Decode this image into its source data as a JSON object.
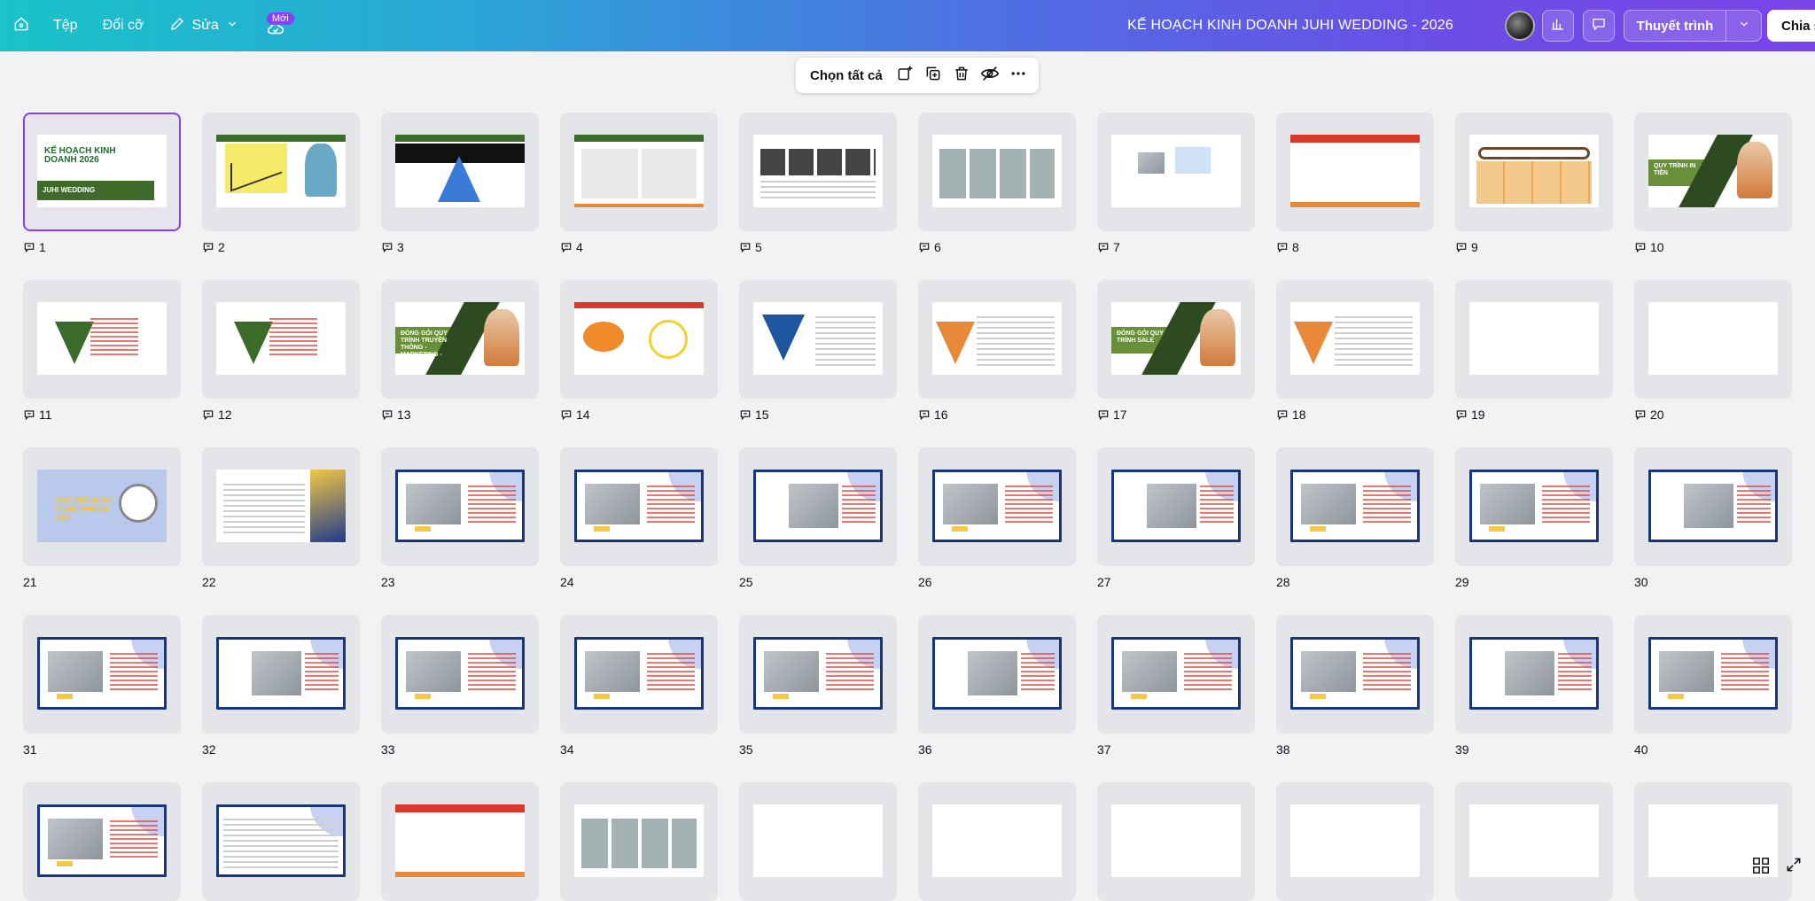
{
  "topbar": {
    "menu_file": "Tệp",
    "menu_resize": "Đổi cỡ",
    "menu_edit": "Sửa",
    "new_badge": "Mới",
    "doc_title": "KẾ HOẠCH KINH DOANH JUHI WEDDING - 2026",
    "present_label": "Thuyết trình",
    "share_label": "Chia s"
  },
  "floatbar": {
    "select_all": "Chọn tất cả"
  },
  "cover_slide": {
    "title": "KẾ HOẠCH KINH DOANH 2026",
    "subtitle": "JUHI WEDDING"
  },
  "slide_texts": {
    "s10": "QUY TRÌNH IN TIỀN",
    "s13": "ĐÓNG GÓI QUY TRÌNH TRUYỀN THÔNG - MARKETING - THU LẠO",
    "s17": "ĐÓNG GÓI QUY TRÌNH SALE",
    "s21": "QUY TRÌNH SỬ DỤNG PHÒNG VÁY"
  },
  "slides": [
    {
      "n": "1",
      "comment": true,
      "type": "title",
      "selected": true
    },
    {
      "n": "2",
      "comment": true,
      "type": "zig"
    },
    {
      "n": "3",
      "comment": true,
      "type": "pyramid3"
    },
    {
      "n": "4",
      "comment": true,
      "type": "grid4"
    },
    {
      "n": "5",
      "comment": true,
      "type": "photorow"
    },
    {
      "n": "6",
      "comment": true,
      "type": "photos6"
    },
    {
      "n": "7",
      "comment": true,
      "type": "diagram"
    },
    {
      "n": "8",
      "comment": true,
      "type": "redhdr"
    },
    {
      "n": "9",
      "comment": true,
      "type": "cols"
    },
    {
      "n": "10",
      "comment": true,
      "type": "cover",
      "text": "s10"
    },
    {
      "n": "11",
      "comment": true,
      "type": "pyrgreen"
    },
    {
      "n": "12",
      "comment": true,
      "type": "pyrgreen"
    },
    {
      "n": "13",
      "comment": true,
      "type": "cover",
      "text": "s13"
    },
    {
      "n": "14",
      "comment": true,
      "type": "bubble"
    },
    {
      "n": "15",
      "comment": true,
      "type": "pyrblue"
    },
    {
      "n": "16",
      "comment": true,
      "type": "funnel"
    },
    {
      "n": "17",
      "comment": true,
      "type": "cover",
      "text": "s17"
    },
    {
      "n": "18",
      "comment": true,
      "type": "funnel"
    },
    {
      "n": "19",
      "comment": true,
      "type": "blank"
    },
    {
      "n": "20",
      "comment": true,
      "type": "blank"
    },
    {
      "n": "21",
      "comment": false,
      "type": "hero",
      "text": "s21"
    },
    {
      "n": "22",
      "comment": false,
      "type": "docyel"
    },
    {
      "n": "23",
      "comment": false,
      "type": "frameA"
    },
    {
      "n": "24",
      "comment": false,
      "type": "frameA"
    },
    {
      "n": "25",
      "comment": false,
      "type": "frameB"
    },
    {
      "n": "26",
      "comment": false,
      "type": "frameA"
    },
    {
      "n": "27",
      "comment": false,
      "type": "frameB"
    },
    {
      "n": "28",
      "comment": false,
      "type": "frameA"
    },
    {
      "n": "29",
      "comment": false,
      "type": "frameA"
    },
    {
      "n": "30",
      "comment": false,
      "type": "frameB"
    },
    {
      "n": "31",
      "comment": false,
      "type": "frameA"
    },
    {
      "n": "32",
      "comment": false,
      "type": "frameB"
    },
    {
      "n": "33",
      "comment": false,
      "type": "frameA"
    },
    {
      "n": "34",
      "comment": false,
      "type": "frameA"
    },
    {
      "n": "35",
      "comment": false,
      "type": "frameA"
    },
    {
      "n": "36",
      "comment": false,
      "type": "frameB"
    },
    {
      "n": "37",
      "comment": false,
      "type": "frameA"
    },
    {
      "n": "38",
      "comment": false,
      "type": "frameA"
    },
    {
      "n": "39",
      "comment": false,
      "type": "frameB"
    },
    {
      "n": "40",
      "comment": false,
      "type": "frameA"
    },
    {
      "n": "",
      "comment": false,
      "type": "frameA"
    },
    {
      "n": "",
      "comment": false,
      "type": "lines"
    },
    {
      "n": "",
      "comment": false,
      "type": "redhdr"
    },
    {
      "n": "",
      "comment": false,
      "type": "photos6"
    },
    {
      "n": "",
      "comment": false,
      "type": "blank"
    },
    {
      "n": "",
      "comment": false,
      "type": "blank"
    },
    {
      "n": "",
      "comment": false,
      "type": "blank"
    },
    {
      "n": "",
      "comment": false,
      "type": "blank"
    },
    {
      "n": "",
      "comment": false,
      "type": "blank"
    },
    {
      "n": "",
      "comment": false,
      "type": "blank"
    }
  ]
}
